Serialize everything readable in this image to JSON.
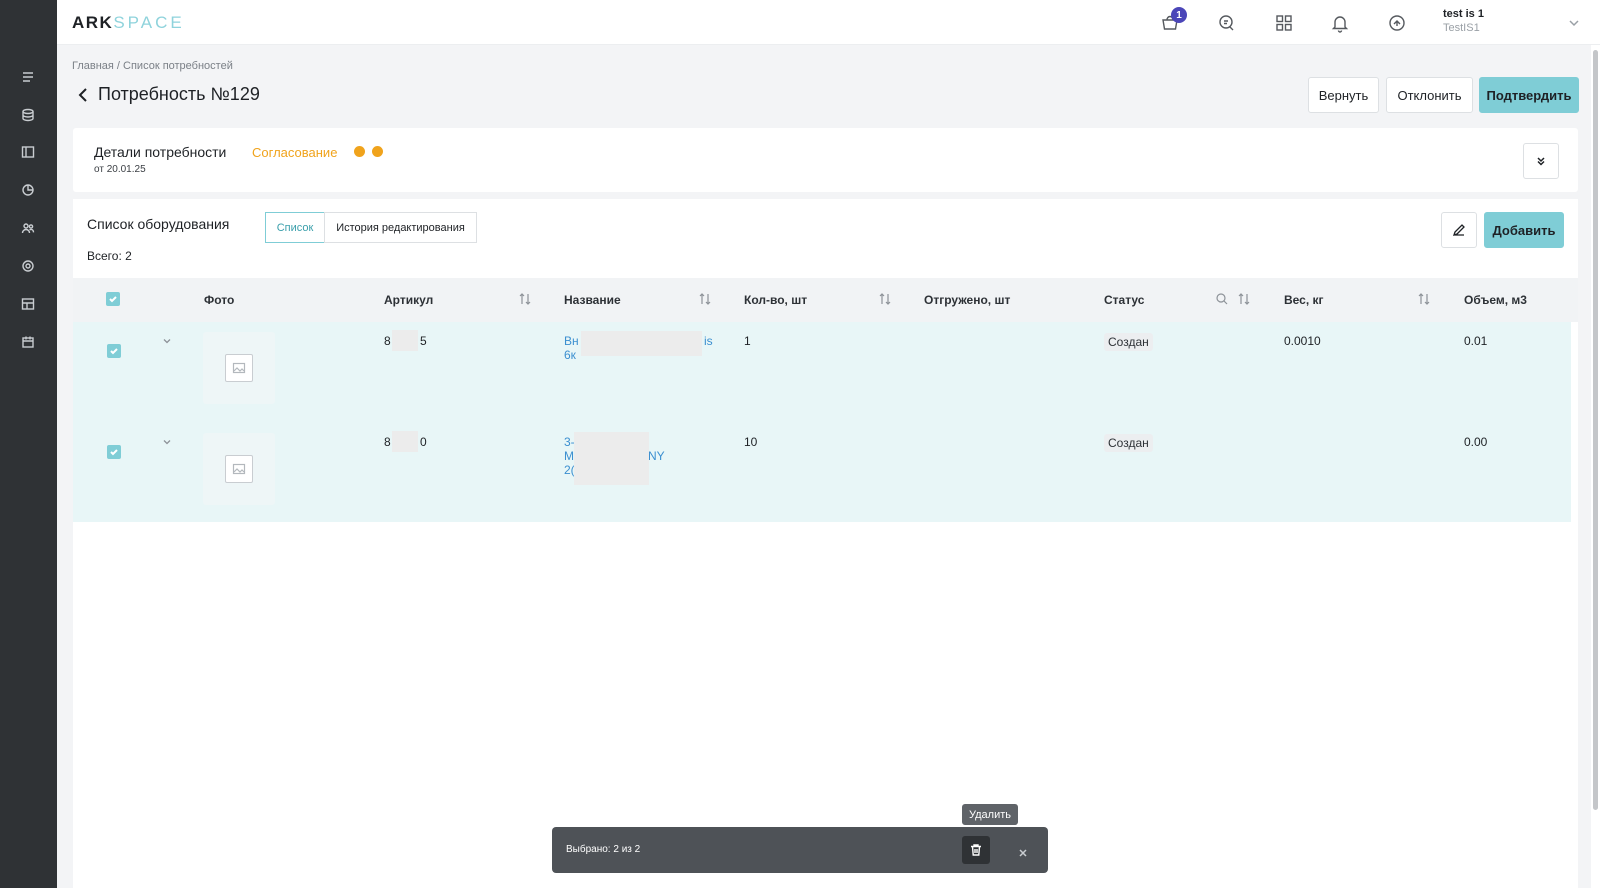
{
  "header": {
    "logo_left": "ARK",
    "logo_right": "SPACE",
    "cart_badge": "1",
    "user_name": "test is 1",
    "user_login": "TestIS1",
    "icons": [
      "cart-icon",
      "chat-icon",
      "apps-grid-icon",
      "bell-icon",
      "sync-icon",
      "chevron-down-icon"
    ]
  },
  "sidebar": {
    "icons": [
      "list-icon",
      "database-icon",
      "layout-icon",
      "chart-icon",
      "users-icon",
      "settings-icon",
      "catalog-icon",
      "calendar-icon"
    ]
  },
  "breadcrumb": "Главная / Список потребностей",
  "page": {
    "title": "Потребность №129",
    "btn_return": "Вернуть",
    "btn_reject": "Отклонить",
    "btn_confirm": "Подтвердить"
  },
  "details": {
    "title": "Детали потребности",
    "status": "Согласование",
    "date": "от 20.01.25",
    "status_color": "#f0a31c"
  },
  "equipment": {
    "title": "Список оборудования",
    "tab_list": "Список",
    "tab_history": "История редактирования",
    "total": "Всего: 2",
    "btn_add": "Добавить",
    "columns": {
      "photo": "Фото",
      "article": "Артикул",
      "name": "Название",
      "qty": "Кол-во, шт",
      "shipped": "Отгружено, шт",
      "status": "Статус",
      "weight": "Вес, кг",
      "volume": "Объем, м3"
    },
    "rows": [
      {
        "article_start": "8",
        "article_end": "5",
        "name_line1_start": "Вн",
        "name_line1_end": "is",
        "name_line2": "6к",
        "qty": "1",
        "shipped": "",
        "status": "Создан",
        "weight": "0.0010",
        "volume": "0.01"
      },
      {
        "article_start": "8",
        "article_end": "0",
        "name_line1_start": "3-",
        "name_line2_start": "М",
        "name_line2_end": "NY",
        "name_line3": "2(",
        "qty": "10",
        "shipped": "",
        "status": "Создан",
        "weight": "",
        "volume": "0.00"
      }
    ]
  },
  "action_bar": {
    "selected_text": "Выбрано: 2 из 2",
    "tooltip": "Удалить"
  },
  "colors": {
    "accent": "#7fcdd6",
    "sidebar": "#2f3235",
    "link": "#3b8fd0",
    "selected_row": "#e8f6f7"
  }
}
